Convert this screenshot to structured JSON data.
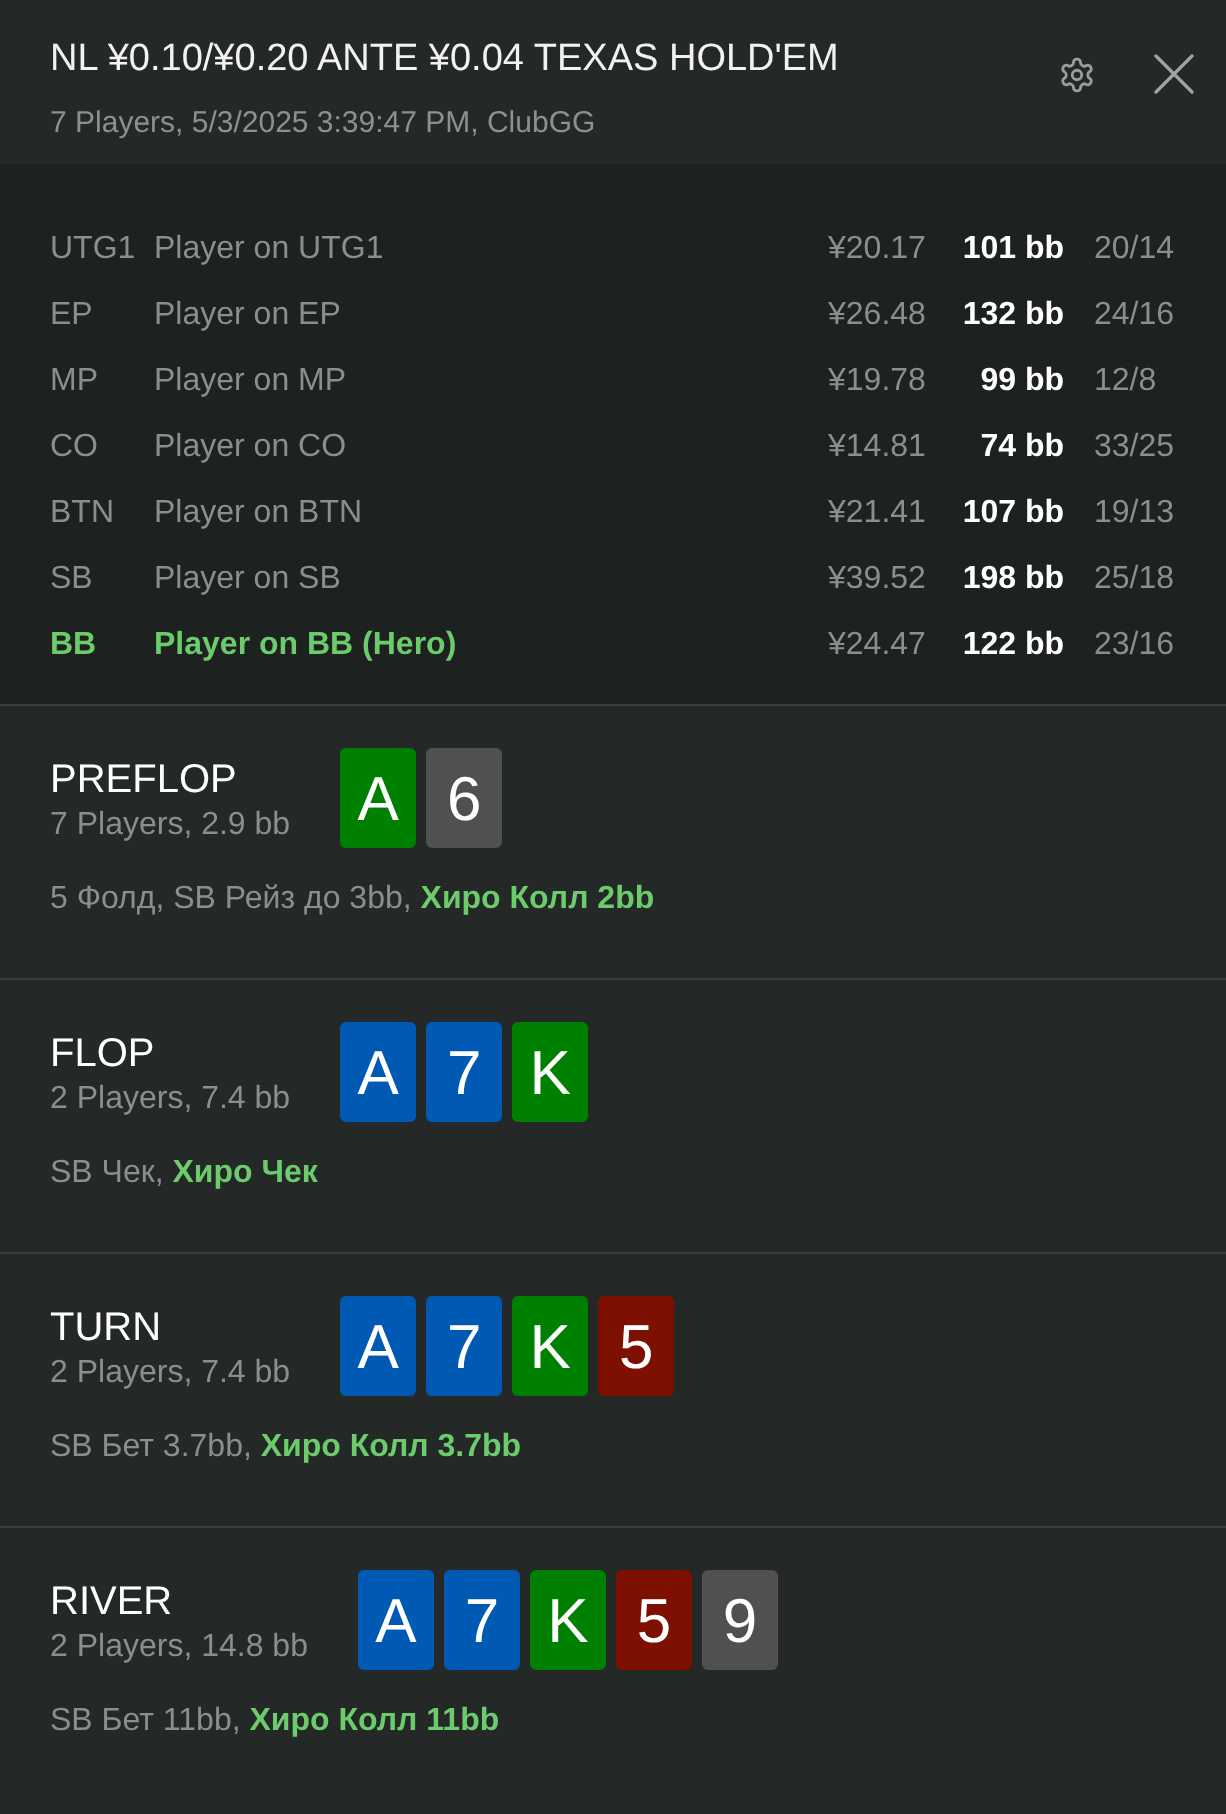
{
  "header": {
    "title": "NL ¥0.10/¥0.20 ANTE ¥0.04 TEXAS HOLD'EM",
    "subtitle": "7 Players, 5/3/2025 3:39:47 PM, ClubGG"
  },
  "players": [
    {
      "position": "UTG1",
      "name": "Player on UTG1",
      "stack": "¥20.17",
      "stack_bb": "101 bb",
      "stats": "20/14",
      "hero": false
    },
    {
      "position": "EP",
      "name": "Player on EP",
      "stack": "¥26.48",
      "stack_bb": "132 bb",
      "stats": "24/16",
      "hero": false
    },
    {
      "position": "MP",
      "name": "Player on MP",
      "stack": "¥19.78",
      "stack_bb": "99 bb",
      "stats": "12/8",
      "hero": false
    },
    {
      "position": "CO",
      "name": "Player on CO",
      "stack": "¥14.81",
      "stack_bb": "74 bb",
      "stats": "33/25",
      "hero": false
    },
    {
      "position": "BTN",
      "name": "Player on BTN",
      "stack": "¥21.41",
      "stack_bb": "107 bb",
      "stats": "19/13",
      "hero": false
    },
    {
      "position": "SB",
      "name": "Player on SB",
      "stack": "¥39.52",
      "stack_bb": "198 bb",
      "stats": "25/18",
      "hero": false
    },
    {
      "position": "BB",
      "name": "Player on BB (Hero)",
      "stack": "¥24.47",
      "stack_bb": "122 bb",
      "stats": "23/16",
      "hero": true
    }
  ],
  "streets": [
    {
      "name": "PREFLOP",
      "summary": "7 Players, 2.9 bb",
      "cards": [
        {
          "rank": "A",
          "color": "#008000"
        },
        {
          "rank": "6",
          "color": "#505050"
        }
      ],
      "actions": "5 Фолд, SB Рейз до 3bb, **Хиро Колл 2bb**"
    },
    {
      "name": "FLOP",
      "summary": "2 Players, 7.4 bb",
      "cards": [
        {
          "rank": "A",
          "color": "#0059b3"
        },
        {
          "rank": "7",
          "color": "#0059b3"
        },
        {
          "rank": "K",
          "color": "#008000"
        }
      ],
      "actions": "SB Чек, **Хиро Чек**"
    },
    {
      "name": "TURN",
      "summary": "2 Players, 7.4 bb",
      "cards": [
        {
          "rank": "A",
          "color": "#0059b3"
        },
        {
          "rank": "7",
          "color": "#0059b3"
        },
        {
          "rank": "K",
          "color": "#008000"
        },
        {
          "rank": "5",
          "color": "#7d1000"
        }
      ],
      "actions": "SB Бет 3.7bb, **Хиро Колл 3.7bb**"
    },
    {
      "name": "RIVER",
      "summary": "2 Players, 14.8 bb",
      "cards": [
        {
          "rank": "A",
          "color": "#0059b3"
        },
        {
          "rank": "7",
          "color": "#0059b3"
        },
        {
          "rank": "K",
          "color": "#008000"
        },
        {
          "rank": "5",
          "color": "#7d1000"
        },
        {
          "rank": "9",
          "color": "#505050"
        }
      ],
      "actions": "SB Бет 11bb, **Хиро Колл 11bb**"
    }
  ]
}
